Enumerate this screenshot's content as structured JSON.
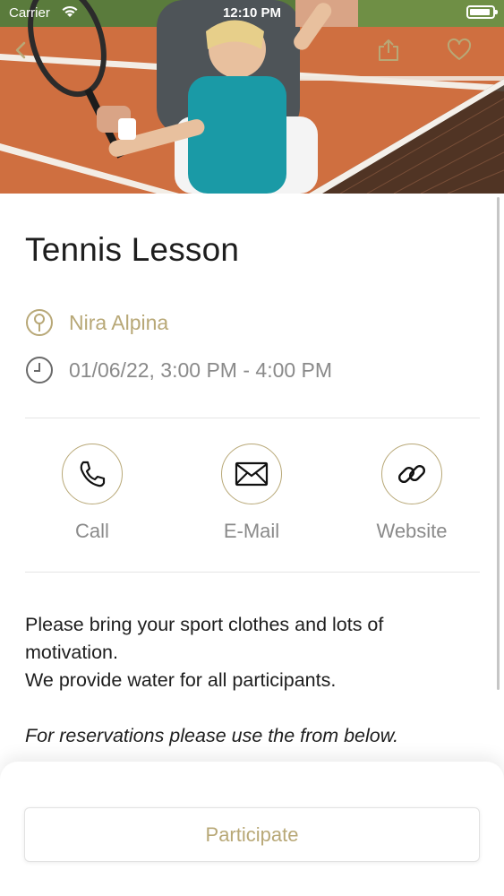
{
  "status_bar": {
    "carrier": "Carrier",
    "time": "12:10 PM"
  },
  "hero": {
    "image_subject": "tennis-lesson-photo"
  },
  "event": {
    "title": "Tennis Lesson",
    "location": "Nira Alpina",
    "datetime": "01/06/22, 3:00 PM - 4:00 PM"
  },
  "actions": [
    {
      "label": "Call",
      "icon": "phone-icon"
    },
    {
      "label": "E-Mail",
      "icon": "envelope-icon"
    },
    {
      "label": "Website",
      "icon": "link-icon"
    }
  ],
  "description": {
    "line1": "Please bring your sport clothes and lots of motivation.",
    "line2": "We provide water for all participants.",
    "note": "For reservations please use the from below."
  },
  "footer": {
    "participate_label": "Participate"
  },
  "colors": {
    "accent": "#b8a877",
    "text": "#1e1e1e",
    "muted": "#8a8a8a"
  }
}
